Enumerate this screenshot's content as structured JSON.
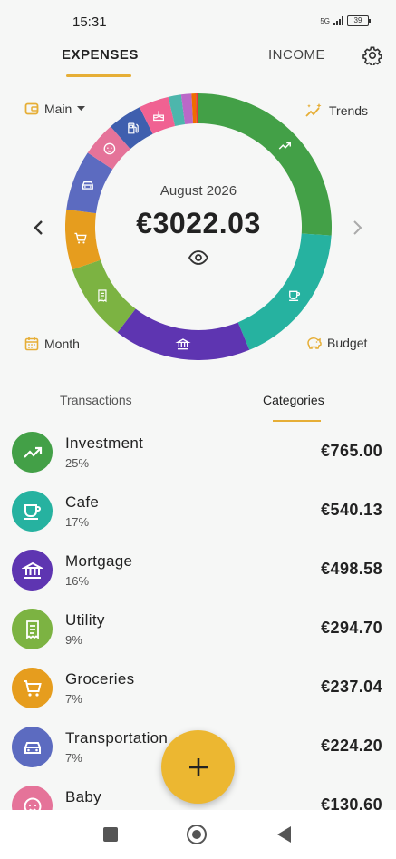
{
  "status": {
    "time": "15:31",
    "network": "5G",
    "battery": "39"
  },
  "tabs": {
    "expenses": "EXPENSES",
    "income": "INCOME"
  },
  "account_selector": "Main",
  "trends_label": "Trends",
  "month_label": "Month",
  "budget_label": "Budget",
  "summary": {
    "period": "August 2026",
    "total": "€3022.03"
  },
  "subtabs": {
    "transactions": "Transactions",
    "categories": "Categories"
  },
  "categories": [
    {
      "name": "Investment",
      "percent": "25%",
      "amount": "€765.00",
      "color": "#43a047",
      "icon": "trending-up-icon"
    },
    {
      "name": "Cafe",
      "percent": "17%",
      "amount": "€540.13",
      "color": "#26b2a0",
      "icon": "coffee-cup-icon"
    },
    {
      "name": "Mortgage",
      "percent": "16%",
      "amount": "€498.58",
      "color": "#5e35b1",
      "icon": "bank-icon"
    },
    {
      "name": "Utility",
      "percent": "9%",
      "amount": "€294.70",
      "color": "#7cb342",
      "icon": "receipt-icon"
    },
    {
      "name": "Groceries",
      "percent": "7%",
      "amount": "€237.04",
      "color": "#e69d1e",
      "icon": "cart-icon"
    },
    {
      "name": "Transportation",
      "percent": "7%",
      "amount": "€224.20",
      "color": "#5c6bc0",
      "icon": "car-icon"
    },
    {
      "name": "Baby",
      "percent": "4%",
      "amount": "€130.60",
      "color": "#e57399",
      "icon": "baby-face-icon"
    }
  ],
  "ring_extra": [
    {
      "percent": 4,
      "color": "#3f5fae"
    },
    {
      "percent": 3.5,
      "color": "#f06292"
    },
    {
      "percent": 1.5,
      "color": "#4db6ac"
    },
    {
      "percent": 1.2,
      "color": "#ba68c8"
    },
    {
      "percent": 0.5,
      "color": "#ef6c00"
    },
    {
      "percent": 0.3,
      "color": "#e53935"
    }
  ],
  "colors": {
    "accent": "#ecb731"
  }
}
